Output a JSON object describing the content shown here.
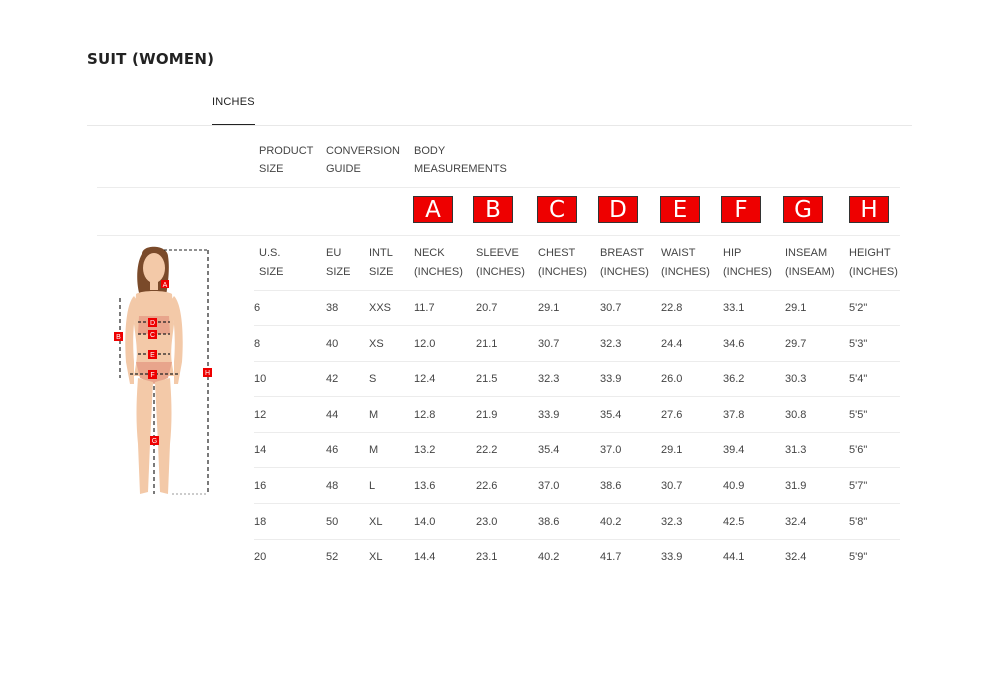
{
  "title": "SUIT (WOMEN)",
  "tab": "INCHES",
  "headers": {
    "product_size": [
      "PRODUCT",
      "SIZE"
    ],
    "conversion_guide": [
      "CONVERSION",
      "GUIDE"
    ],
    "body_measurements": [
      "BODY",
      "MEASUREMENTS"
    ]
  },
  "letters": [
    "A",
    "B",
    "C",
    "D",
    "E",
    "F",
    "G",
    "H"
  ],
  "columns": [
    [
      "U.S.",
      "SIZE"
    ],
    [
      "EU",
      "SIZE"
    ],
    [
      "INTL",
      "SIZE"
    ],
    [
      "NECK",
      "(INCHES)"
    ],
    [
      "SLEEVE",
      "(INCHES)"
    ],
    [
      "CHEST",
      "(INCHES)"
    ],
    [
      "BREAST",
      "(INCHES)"
    ],
    [
      "WAIST",
      "(INCHES)"
    ],
    [
      "HIP",
      "(INCHES)"
    ],
    [
      "INSEAM",
      "(INSEAM)"
    ],
    [
      "HEIGHT",
      "(INCHES)"
    ]
  ],
  "rows": [
    [
      "6",
      "38",
      "XXS",
      "11.7",
      "20.7",
      "29.1",
      "30.7",
      "22.8",
      "33.1",
      "29.1",
      "5'2\""
    ],
    [
      "8",
      "40",
      "XS",
      "12.0",
      "21.1",
      "30.7",
      "32.3",
      "24.4",
      "34.6",
      "29.7",
      "5'3\""
    ],
    [
      "10",
      "42",
      "S",
      "12.4",
      "21.5",
      "32.3",
      "33.9",
      "26.0",
      "36.2",
      "30.3",
      "5'4\""
    ],
    [
      "12",
      "44",
      "M",
      "12.8",
      "21.9",
      "33.9",
      "35.4",
      "27.6",
      "37.8",
      "30.8",
      "5'5\""
    ],
    [
      "14",
      "46",
      "M",
      "13.2",
      "22.2",
      "35.4",
      "37.0",
      "29.1",
      "39.4",
      "31.3",
      "5'6\""
    ],
    [
      "16",
      "48",
      "L",
      "13.6",
      "22.6",
      "37.0",
      "38.6",
      "30.7",
      "40.9",
      "31.9",
      "5'7\""
    ],
    [
      "18",
      "50",
      "XL",
      "14.0",
      "23.0",
      "38.6",
      "40.2",
      "32.3",
      "42.5",
      "32.4",
      "5'8\""
    ],
    [
      "20",
      "52",
      "XL",
      "14.4",
      "23.1",
      "40.2",
      "41.7",
      "33.9",
      "44.1",
      "32.4",
      "5'9\""
    ]
  ],
  "figure_markers": [
    "A",
    "B",
    "C",
    "D",
    "E",
    "F",
    "G",
    "H"
  ],
  "colors": {
    "marker_red": "#ee0000",
    "skin": "#f3c9a8",
    "hair": "#7a4a2a",
    "swimsuit": "#e8a58c"
  }
}
